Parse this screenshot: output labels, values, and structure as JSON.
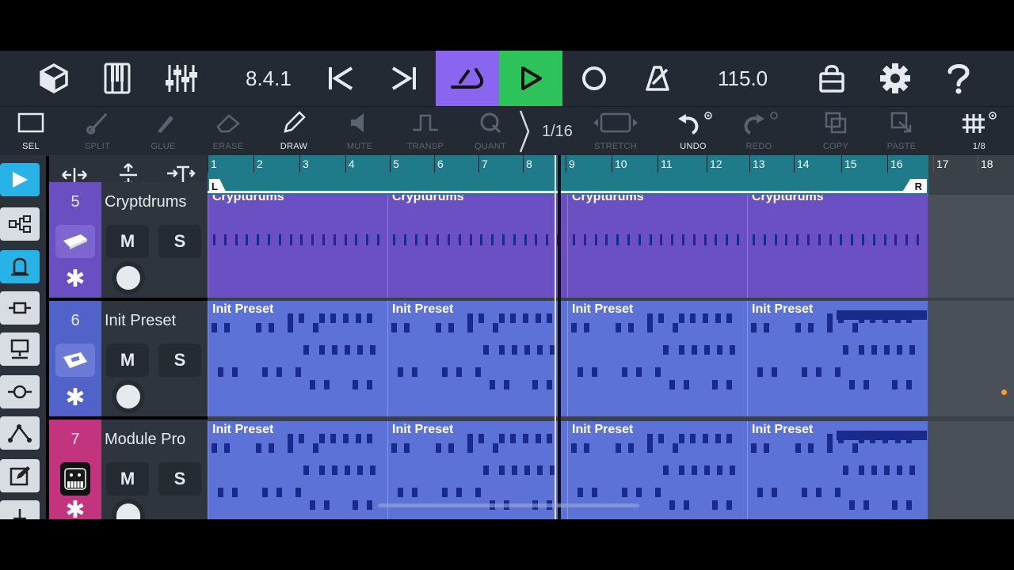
{
  "colors": {
    "accent_cycle": "#8a66f0",
    "accent_play": "#2ec25a",
    "accent_active": "#28b3e8",
    "track_purple": "#6a4fc2",
    "track_blue": "#5163c8",
    "track_pink": "#c2347e",
    "clip_purple": "#6b50c4",
    "clip_blue": "#5c72d6",
    "note": "#1a2a8a",
    "ruler": "#1f7a8a"
  },
  "transport": {
    "position": "8.4.1",
    "tempo": "115.0",
    "icons": [
      "cube-icon",
      "keyboard-icon",
      "mixer-icon",
      "skip-back-icon",
      "skip-forward-icon",
      "cycle-icon",
      "play-icon",
      "record-icon",
      "metronome-icon",
      "shop-icon",
      "gear-icon",
      "help-icon"
    ]
  },
  "tools": {
    "sel": "SEL",
    "split": "SPLIT",
    "glue": "GLUE",
    "erase": "ERASE",
    "draw": "DRAW",
    "mute": "MUTE",
    "transp": "TRANSP",
    "quant": "QUANT",
    "quant_value": "1/16",
    "stretch": "STRETCH",
    "undo": "UNDO",
    "redo": "REDO",
    "copy": "COPY",
    "paste": "PASTE",
    "grid": "1/8"
  },
  "ruler": {
    "bars": [
      "1",
      "2",
      "3",
      "4",
      "5",
      "6",
      "7",
      "8",
      "9",
      "10",
      "11",
      "12",
      "13",
      "14",
      "15",
      "16",
      "17",
      "18"
    ],
    "left_locator": "L",
    "right_locator": "R"
  },
  "tracks": [
    {
      "number": "5",
      "name": "Cryptdrums",
      "mute": "M",
      "solo": "S",
      "clips": [
        "Cryptdrums",
        "Cryptdrums",
        "Cryptdrums",
        "Cryptdrums"
      ]
    },
    {
      "number": "6",
      "name": "Init Preset",
      "mute": "M",
      "solo": "S",
      "clips": [
        "Init Preset",
        "Init Preset",
        "Init Preset",
        "Init Preset"
      ]
    },
    {
      "number": "7",
      "name": "Module Pro",
      "mute": "M",
      "solo": "S",
      "clips": [
        "Init Preset",
        "Init Preset",
        "Init Preset",
        "Init Preset"
      ]
    }
  ]
}
